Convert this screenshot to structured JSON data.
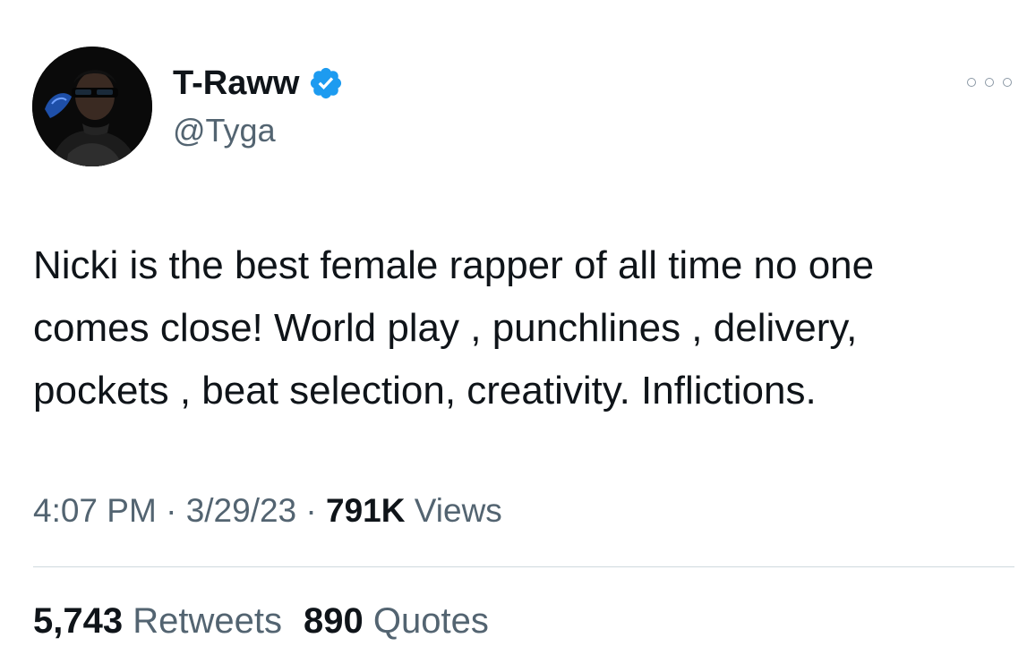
{
  "author": {
    "display_name": "T-Raww",
    "handle": "@Tyga",
    "verified": true,
    "verified_color": "#1d9bf0",
    "avatar_icon": "profile-photo"
  },
  "more_icon": "more-options-icon",
  "tweet": {
    "text": "Nicki is the best female rapper of all time no one\ncomes close! World play , punchlines , delivery,\npockets , beat selection, creativity. Inflictions."
  },
  "meta": {
    "time": "4:07 PM",
    "sep1": " · ",
    "date": "3/29/23",
    "sep2": " · ",
    "views_count": "791K",
    "views_label": " Views"
  },
  "stats": {
    "retweets_count": "5,743",
    "retweets_label": "Retweets",
    "quotes_count": "890",
    "quotes_label": "Quotes"
  },
  "colors": {
    "text_primary": "#0f1419",
    "text_secondary": "#536471",
    "divider": "#cfd9de"
  }
}
